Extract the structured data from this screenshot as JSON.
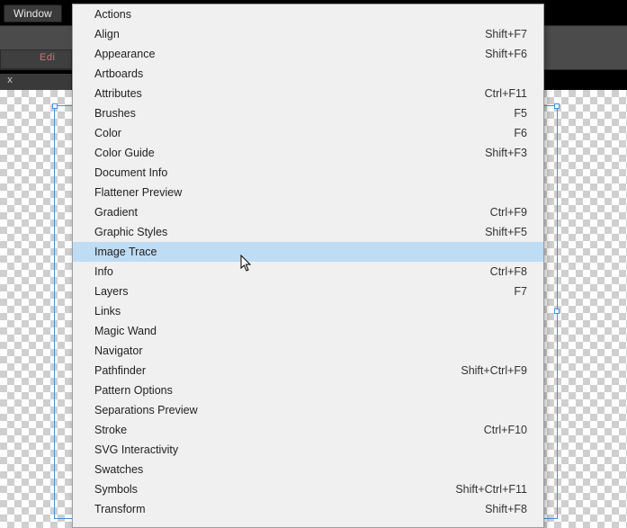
{
  "menubar": {
    "window_label": "Window"
  },
  "toolbar": {
    "edit_label": "Edi"
  },
  "tab": {
    "close_glyph": "x"
  },
  "menu": {
    "items": [
      {
        "label": "Actions",
        "shortcut": ""
      },
      {
        "label": "Align",
        "shortcut": "Shift+F7"
      },
      {
        "label": "Appearance",
        "shortcut": "Shift+F6"
      },
      {
        "label": "Artboards",
        "shortcut": ""
      },
      {
        "label": "Attributes",
        "shortcut": "Ctrl+F11"
      },
      {
        "label": "Brushes",
        "shortcut": "F5"
      },
      {
        "label": "Color",
        "shortcut": "F6"
      },
      {
        "label": "Color Guide",
        "shortcut": "Shift+F3"
      },
      {
        "label": "Document Info",
        "shortcut": ""
      },
      {
        "label": "Flattener Preview",
        "shortcut": ""
      },
      {
        "label": "Gradient",
        "shortcut": "Ctrl+F9"
      },
      {
        "label": "Graphic Styles",
        "shortcut": "Shift+F5"
      },
      {
        "label": "Image Trace",
        "shortcut": ""
      },
      {
        "label": "Info",
        "shortcut": "Ctrl+F8"
      },
      {
        "label": "Layers",
        "shortcut": "F7"
      },
      {
        "label": "Links",
        "shortcut": ""
      },
      {
        "label": "Magic Wand",
        "shortcut": ""
      },
      {
        "label": "Navigator",
        "shortcut": ""
      },
      {
        "label": "Pathfinder",
        "shortcut": "Shift+Ctrl+F9"
      },
      {
        "label": "Pattern Options",
        "shortcut": ""
      },
      {
        "label": "Separations Preview",
        "shortcut": ""
      },
      {
        "label": "Stroke",
        "shortcut": "Ctrl+F10"
      },
      {
        "label": "SVG Interactivity",
        "shortcut": ""
      },
      {
        "label": "Swatches",
        "shortcut": ""
      },
      {
        "label": "Symbols",
        "shortcut": "Shift+Ctrl+F11"
      },
      {
        "label": "Transform",
        "shortcut": "Shift+F8"
      }
    ],
    "highlight_index": 12
  }
}
